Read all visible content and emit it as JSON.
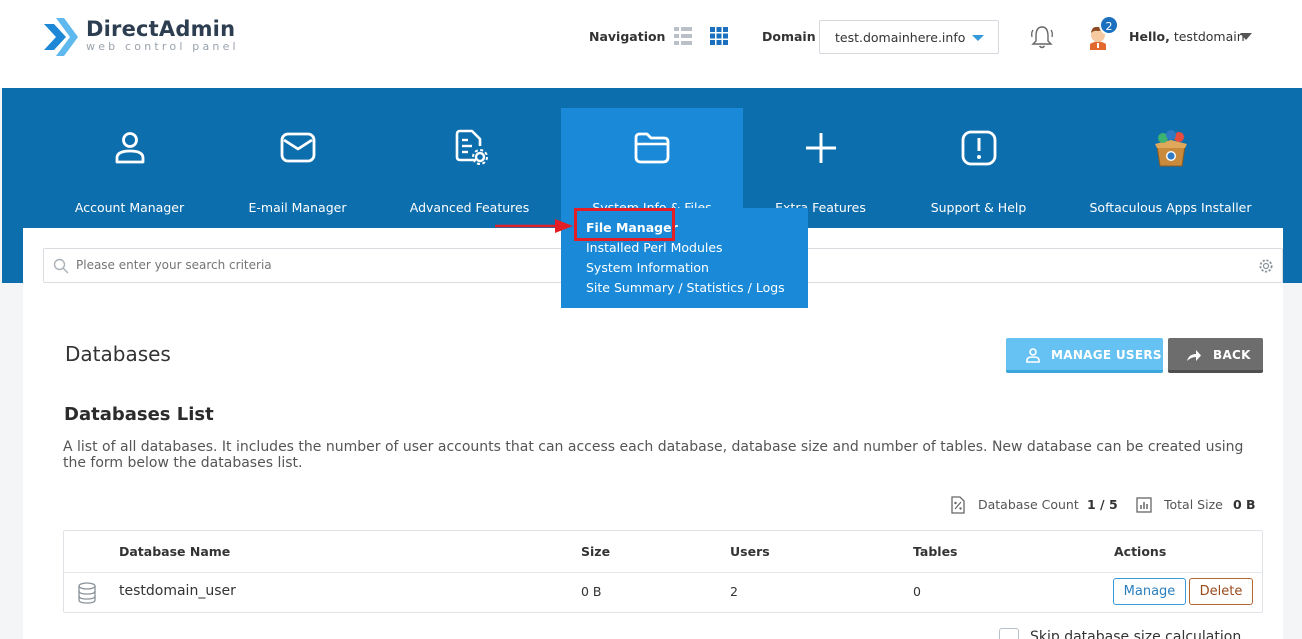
{
  "app": {
    "logo_title": "DirectAdmin",
    "logo_subtitle": "web control panel"
  },
  "header": {
    "navigation_label": "Navigation",
    "domain_label": "Domain",
    "domain_value": "test.domainhere.info",
    "notification_count": "2",
    "greeting": "Hello,",
    "username": "testdomain"
  },
  "nav": {
    "items": [
      {
        "label": "Account Manager",
        "icon": "user-icon"
      },
      {
        "label": "E-mail Manager",
        "icon": "envelope-icon"
      },
      {
        "label": "Advanced Features",
        "icon": "document-gear-icon"
      },
      {
        "label": "System Info & Files",
        "icon": "folder-icon",
        "active": true
      },
      {
        "label": "Extra Features",
        "icon": "plus-icon"
      },
      {
        "label": "Support & Help",
        "icon": "exclamation-icon"
      },
      {
        "label": "Softaculous Apps Installer",
        "icon": "softaculous-box-icon"
      }
    ],
    "dropdown": [
      "File Manager",
      "Installed Perl Modules",
      "System Information",
      "Site Summary / Statistics / Logs"
    ]
  },
  "search": {
    "placeholder": "Please enter your search criteria"
  },
  "page": {
    "title": "Databases",
    "manage_users_label": "MANAGE USERS",
    "back_label": "BACK",
    "list_heading": "Databases List",
    "list_description": "A list of all databases. It includes the number of user accounts that can access each database, database size and number of tables. New database can be created using the form below the databases list.",
    "db_count_label": "Database Count",
    "db_count_value": "1 / 5",
    "total_size_label": "Total Size",
    "total_size_value": "0 B"
  },
  "table": {
    "columns": [
      "Database Name",
      "Size",
      "Users",
      "Tables",
      "Actions"
    ],
    "rows": [
      {
        "name": "testdomain_user",
        "size": "0 B",
        "users": "2",
        "tables": "0"
      }
    ],
    "manage_label": "Manage",
    "delete_label": "Delete"
  },
  "options": {
    "skip_size_label": "Skip database size calculation"
  },
  "colors": {
    "nav_bg": "#0d6eae",
    "nav_active": "#1a8ad8",
    "highlight": "#e31e24",
    "manage_users_btn": "#66c2f2",
    "back_btn": "#6d6d6d"
  }
}
